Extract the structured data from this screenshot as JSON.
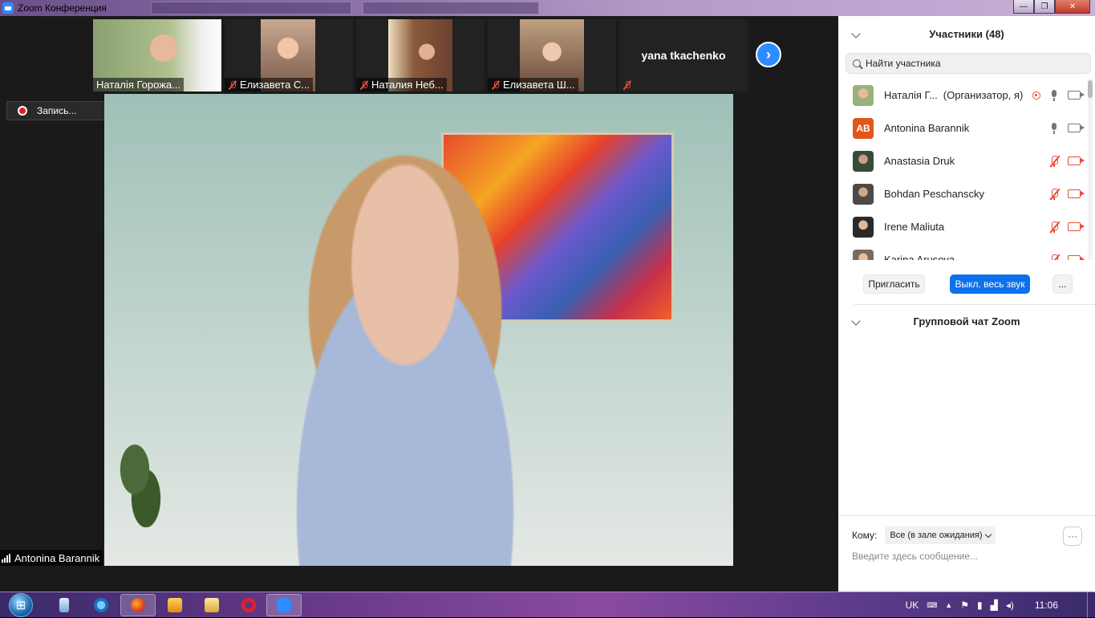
{
  "window": {
    "title": "Zoom Конференция",
    "min": "—",
    "max": "❐",
    "close": "✕"
  },
  "thumbnails": [
    {
      "name": "Наталія Горожа...",
      "muted": false,
      "bg": "#9bb07a"
    },
    {
      "name": "Елизавета С...",
      "muted": true,
      "bg": "#b08a70"
    },
    {
      "name": "Наталия Неб...",
      "muted": true,
      "bg": "#8a5a3a"
    },
    {
      "name": "Елизавета Ш...",
      "muted": true,
      "bg": "#a07a60"
    },
    {
      "name": "yana tkachenko",
      "muted": true,
      "bg": "#222222"
    }
  ],
  "recording": {
    "label": "Запись..."
  },
  "main_speaker": {
    "name": "Antonina Barannik"
  },
  "panel": {
    "participants_title": "Участники (48)",
    "search_placeholder": "Найти участника",
    "participants": [
      {
        "name": "Наталія Г...",
        "role": "(Организатор, я)",
        "avatar": "photo",
        "mic": "on",
        "cam": "on",
        "recording": true
      },
      {
        "name": "Antonina Barannik",
        "role": "",
        "avatar": "AB",
        "mic": "on",
        "cam": "on",
        "recording": false
      },
      {
        "name": "Anastasia Druk",
        "role": "",
        "avatar": "photo",
        "mic": "off",
        "cam": "off",
        "recording": false
      },
      {
        "name": "Bohdan Peschanscky",
        "role": "",
        "avatar": "photo",
        "mic": "off",
        "cam": "off",
        "recording": false
      },
      {
        "name": "Irene Maliuta",
        "role": "",
        "avatar": "photo",
        "mic": "off",
        "cam": "off",
        "recording": false
      },
      {
        "name": "Karina Arusova",
        "role": "",
        "avatar": "photo",
        "mic": "off",
        "cam": "off",
        "recording": false
      }
    ],
    "invite_label": "Пригласить",
    "mute_all_label": "Выкл. весь звук",
    "more_label": "...",
    "chat_title": "Групповой чат Zoom",
    "to_label": "Кому:",
    "to_value": "Все (в зале ожидания)",
    "chat_more": "···",
    "message_placeholder": "Введите здесь сообщение..."
  },
  "taskbar": {
    "language": "UK",
    "time": "11:06"
  },
  "colors": {
    "accent": "#0e71eb",
    "zoom_blue": "#2d8cff",
    "muted_red": "#e74c3c",
    "avatar_orange": "#e0561b"
  }
}
